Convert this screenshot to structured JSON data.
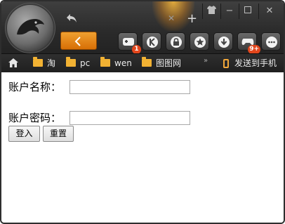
{
  "window": {
    "buttons": [
      "shirt-icon",
      "minimize-icon",
      "maximize-icon",
      "close-icon"
    ]
  },
  "toolbar": {
    "icons": [
      {
        "name": "game-controller-icon",
        "badge": "1"
      },
      {
        "name": "k-icon",
        "badge": ""
      },
      {
        "name": "lock-icon",
        "badge": ""
      },
      {
        "name": "star-icon",
        "badge": ""
      },
      {
        "name": "download-icon",
        "badge": ""
      },
      {
        "name": "gamepad-icon",
        "badge": "9+"
      },
      {
        "name": "more-icon",
        "badge": ""
      }
    ],
    "accent": "#e8860f"
  },
  "bookmarks": {
    "items": [
      "淘",
      "pc",
      "wen",
      "图图网"
    ],
    "send_to_phone": "发送到手机",
    "more": "»"
  },
  "form": {
    "username_label": "账户名称：",
    "username_value": "",
    "password_label": "账户密码：",
    "password_value": "",
    "login_button": "登入",
    "reset_button": "重置"
  }
}
